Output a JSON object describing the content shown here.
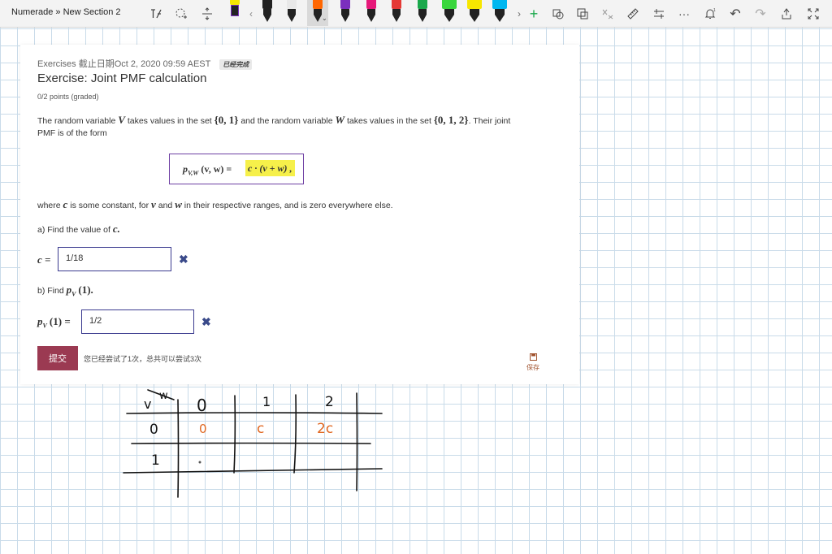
{
  "toolbar": {
    "title": "Numerade » New Section 2",
    "pen_colors": [
      "#222222",
      "#e8e8e8",
      "#ff6600",
      "#7b2fbe",
      "#e6197a",
      "#e53935",
      "#1aa84b",
      "#39d63c",
      "#f7e600",
      "#00b7f0"
    ]
  },
  "exercise": {
    "meta": "Exercises 截止日期Oct 2, 2020 09:59 AEST",
    "status_badge": "已经完成",
    "title": "Exercise: Joint PMF calculation",
    "points": "0/2 points (graded)",
    "intro_1a": "The random variable",
    "var_V": "V",
    "intro_1b": "takes values in the set",
    "set_V": "{0, 1}",
    "intro_1c": "and the random variable",
    "var_W": "W",
    "intro_1d": "takes values in the set",
    "set_W": "{0, 1, 2}",
    "intro_1e": ". Their joint",
    "intro_2": "PMF is of the form",
    "formula_lhs": "p",
    "formula_sub": "V,W",
    "formula_args": "(v, w) =",
    "formula_rhs": "c · (v + w) ,",
    "where_a": "where",
    "where_c": "c",
    "where_b": "is some constant, for",
    "where_v": "v",
    "where_and": "and",
    "where_w": "w",
    "where_rest": "in their respective ranges, and is zero everywhere else.",
    "part_a": "a) Find the value of",
    "part_a_var": "c.",
    "answer_a_label": "c =",
    "answer_a_value": "1/18",
    "part_b": "b) Find",
    "part_b_expr": "p",
    "part_b_sub": "V",
    "part_b_arg": "(1).",
    "answer_b_label_p": "p",
    "answer_b_label_sub": "V",
    "answer_b_label_rest": "(1) =",
    "answer_b_value": "1/2",
    "wrong_mark": "✖",
    "submit_label": "提交",
    "attempts": "您已经尝试了1次，总共可以尝试3次",
    "save_label": "保存"
  },
  "handwritten_table": {
    "corner_v": "v",
    "corner_w": "w",
    "col_headers": [
      "0",
      "1",
      "2"
    ],
    "rows": [
      {
        "v": "0",
        "cells": [
          "0",
          "c",
          "2c"
        ]
      },
      {
        "v": "1",
        "cells": [
          "",
          "",
          ""
        ]
      }
    ]
  }
}
